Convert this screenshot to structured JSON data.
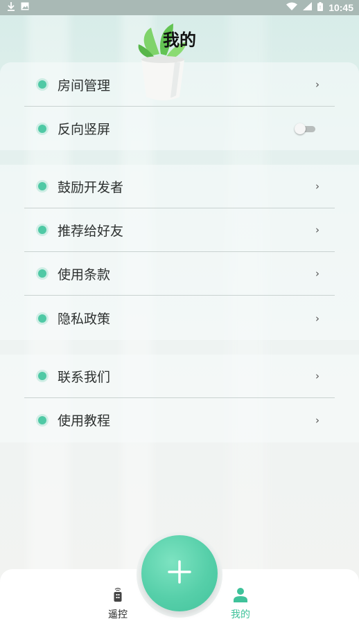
{
  "status_bar": {
    "time": "10:45",
    "left_icons": [
      "download-icon",
      "image-icon"
    ],
    "right_icons": [
      "wifi-icon",
      "signal-icon",
      "battery-icon"
    ]
  },
  "header": {
    "title": "我的"
  },
  "sections": [
    {
      "items": [
        {
          "label": "房间管理",
          "control": "chevron"
        },
        {
          "label": "反向竖屏",
          "control": "toggle",
          "toggle_on": false
        }
      ]
    },
    {
      "items": [
        {
          "label": "鼓励开发者",
          "control": "chevron"
        },
        {
          "label": "推荐给好友",
          "control": "chevron"
        },
        {
          "label": "使用条款",
          "control": "chevron"
        },
        {
          "label": "隐私政策",
          "control": "chevron"
        }
      ]
    },
    {
      "items": [
        {
          "label": "联系我们",
          "control": "chevron"
        },
        {
          "label": "使用教程",
          "control": "chevron"
        }
      ]
    }
  ],
  "chevron_glyph": "›",
  "fab": {
    "icon": "plus-icon"
  },
  "bottom_nav": {
    "items": [
      {
        "label": "遥控",
        "icon": "remote-control-icon",
        "active": false
      },
      {
        "label": "我的",
        "icon": "user-icon",
        "active": true
      }
    ]
  },
  "colors": {
    "accent": "#4fc9a5",
    "active_nav": "#3fc29a",
    "text": "#2d3130",
    "divider": "#c9d2d0"
  }
}
